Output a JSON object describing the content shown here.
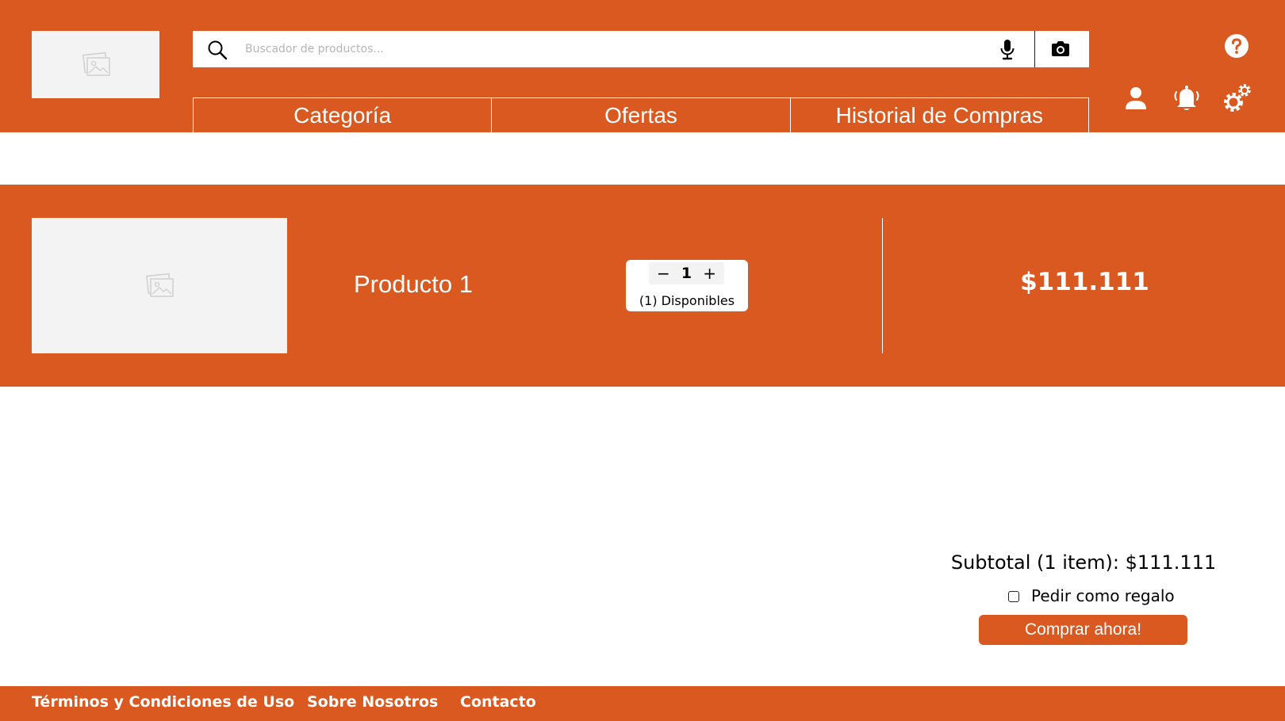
{
  "header": {
    "logo_icon": "image-placeholder-icon",
    "search": {
      "placeholder": "Buscador de productos...",
      "value": "",
      "icons": [
        "search-icon",
        "microphone-icon",
        "camera-icon"
      ]
    },
    "nav": [
      {
        "label": "Categoría"
      },
      {
        "label": "Ofertas"
      },
      {
        "label": "Historial de Compras"
      }
    ],
    "actions": [
      "help-icon",
      "user-icon",
      "bell-icon",
      "gear-icon"
    ]
  },
  "cart": {
    "items": [
      {
        "image_icon": "image-placeholder-icon",
        "name": "Producto 1",
        "quantity": "1",
        "decrement_symbol": "−",
        "increment_symbol": "+",
        "available": "(1) Disponibles",
        "price": "$111.111"
      }
    ]
  },
  "summary": {
    "subtotal": "Subtotal (1 item): $111.111",
    "gift_label": "Pedir como regalo",
    "gift_checked": false,
    "buy_label": "Comprar ahora!"
  },
  "footer": {
    "links": [
      {
        "label": "Términos y Condiciones de Uso"
      },
      {
        "label": "Sobre Nosotros"
      },
      {
        "label": "Contacto"
      }
    ]
  },
  "colors": {
    "brand": "#d95920",
    "placeholder_bg": "#f3f3f3",
    "text_on_brand": "#ffffff"
  }
}
